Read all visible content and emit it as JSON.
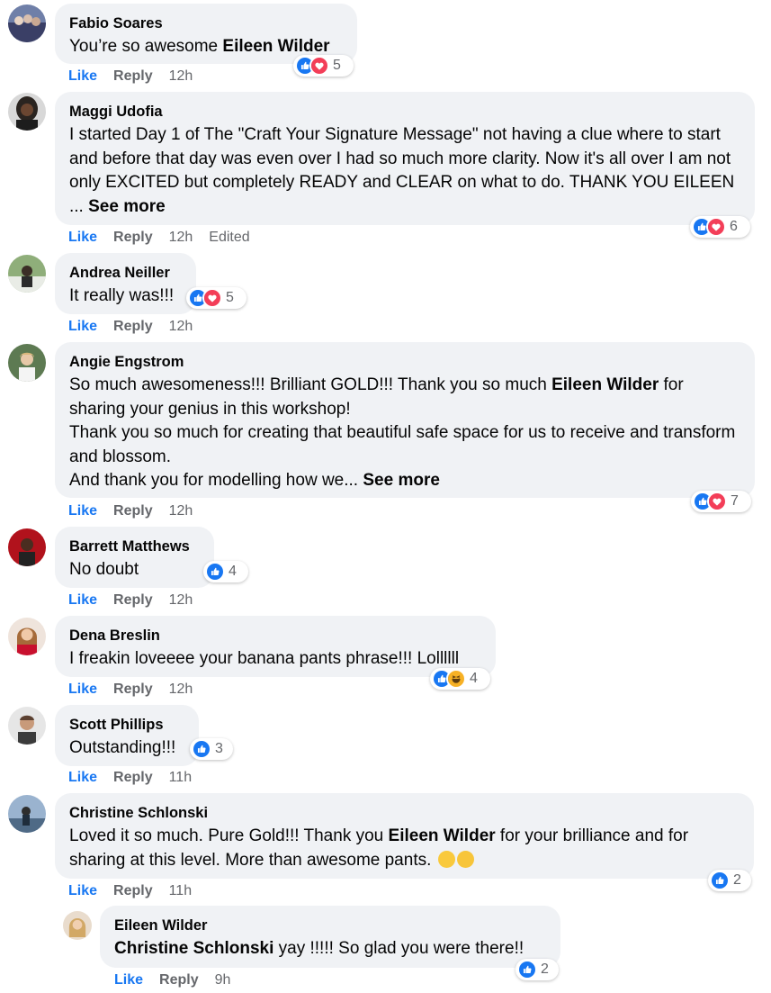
{
  "colors": {
    "like_blue": "#1877f2",
    "love_red": "#f33e58",
    "haha_yellow": "#f7b125",
    "bubble_bg": "#f0f2f5",
    "meta_gray": "#65676b"
  },
  "comments": [
    {
      "author": "Fabio Soares",
      "text_pre": "You’re so awesome ",
      "mention": "Eileen Wilder",
      "text_post": "",
      "like": "Like",
      "reply": "Reply",
      "time": "12h",
      "reaction_count": "5",
      "reactions": [
        "like-icon",
        "love-icon"
      ]
    },
    {
      "author": "Maggi Udofia",
      "text": "I started Day 1 of The \"Craft Your Signature Message\" not having a clue where to start and before that day was even over I had so much more clarity. Now it's all over I am not only EXCITED but completely READY and CLEAR on what to do. THANK YOU EILEEN ... ",
      "see_more": "See more",
      "like": "Like",
      "reply": "Reply",
      "time": "12h",
      "edited": "Edited",
      "reaction_count": "6",
      "reactions": [
        "like-icon",
        "love-icon"
      ]
    },
    {
      "author": "Andrea Neiller",
      "text": "It really was!!!",
      "like": "Like",
      "reply": "Reply",
      "time": "12h",
      "reaction_count": "5",
      "reactions": [
        "like-icon",
        "love-icon"
      ]
    },
    {
      "author": "Angie Engstrom",
      "line1_pre": "So much awesomeness!!! Brilliant GOLD!!! Thank you so much ",
      "mention": "Eileen Wilder",
      "line1_post": " for sharing your genius in this workshop!",
      "line2": "Thank you so much for creating that beautiful safe space for us to receive and transform and blossom.",
      "line3": "And thank you for modelling how we... ",
      "see_more": "See more",
      "like": "Like",
      "reply": "Reply",
      "time": "12h",
      "reaction_count": "7",
      "reactions": [
        "like-icon",
        "love-icon"
      ]
    },
    {
      "author": "Barrett Matthews",
      "text": "No doubt",
      "like": "Like",
      "reply": "Reply",
      "time": "12h",
      "reaction_count": "4",
      "reactions": [
        "like-icon"
      ]
    },
    {
      "author": "Dena Breslin",
      "text": "I freakin loveeee your banana pants phrase!!! Lollllll",
      "like": "Like",
      "reply": "Reply",
      "time": "12h",
      "reaction_count": "4",
      "reactions": [
        "like-icon",
        "haha-icon"
      ]
    },
    {
      "author": "Scott Phillips",
      "text": "Outstanding!!!",
      "like": "Like",
      "reply": "Reply",
      "time": "11h",
      "reaction_count": "3",
      "reactions": [
        "like-icon"
      ]
    },
    {
      "author": "Christine Schlonski",
      "text_pre": "Loved it so much. Pure Gold!!! Thank you ",
      "mention": "Eileen Wilder",
      "text_post": " for your brilliance and for sharing at this level. More than awesome pants. ",
      "like": "Like",
      "reply": "Reply",
      "time": "11h",
      "reaction_count": "2",
      "reactions": [
        "like-icon"
      ]
    },
    {
      "author": "Eileen Wilder",
      "mention": "Christine Schlonski",
      "text_post": " yay !!!!! So glad you were there!!",
      "like": "Like",
      "reply": "Reply",
      "time": "9h",
      "reaction_count": "2",
      "reactions": [
        "like-icon"
      ]
    }
  ]
}
